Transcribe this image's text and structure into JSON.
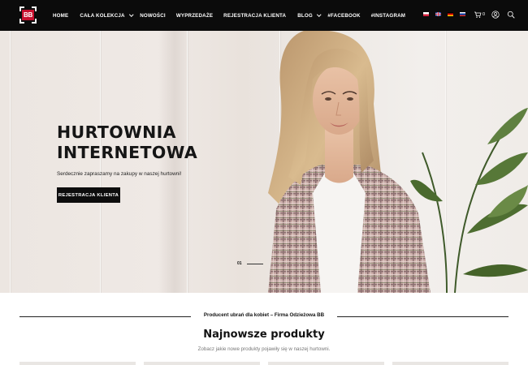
{
  "header": {
    "logo_text": "BB",
    "nav": [
      {
        "label": "HOME",
        "dropdown": false
      },
      {
        "label": "CAŁA KOLEKCJA",
        "dropdown": true
      },
      {
        "label": "NOWOŚCI",
        "dropdown": false
      },
      {
        "label": "WYPRZEDAŻE",
        "dropdown": false
      },
      {
        "label": "REJESTRACJA KLIENTA",
        "dropdown": false
      },
      {
        "label": "BLOG",
        "dropdown": true
      },
      {
        "label": "#FACEBOOK",
        "dropdown": false
      },
      {
        "label": "#INSTAGRAM",
        "dropdown": false
      }
    ],
    "languages": [
      "pl-flag-icon",
      "en-flag-icon",
      "de-flag-icon",
      "ru-flag-icon"
    ],
    "cart_count": "0",
    "icons": [
      "cart-icon",
      "user-icon",
      "search-icon"
    ]
  },
  "hero": {
    "title_line1": "HURTOWNIA",
    "title_line2": "INTERNETOWA",
    "subtitle": "Serdecznie zapraszamy na zakupy w naszej hurtowni!",
    "button_label": "REJESTRACJA KLIENTA",
    "slide_number": "01"
  },
  "tagline": "Producent ubrań dla kobiet – Firma Odzieżowa BB",
  "new_products": {
    "title": "Najnowsze produkty",
    "subtitle": "Zobacz jakie nowe produkty pojawiły się w naszej hurtowni."
  },
  "colors": {
    "header_bg": "#0b0b0b",
    "accent_red": "#c8102e",
    "button_bg": "#0d0d0d"
  }
}
